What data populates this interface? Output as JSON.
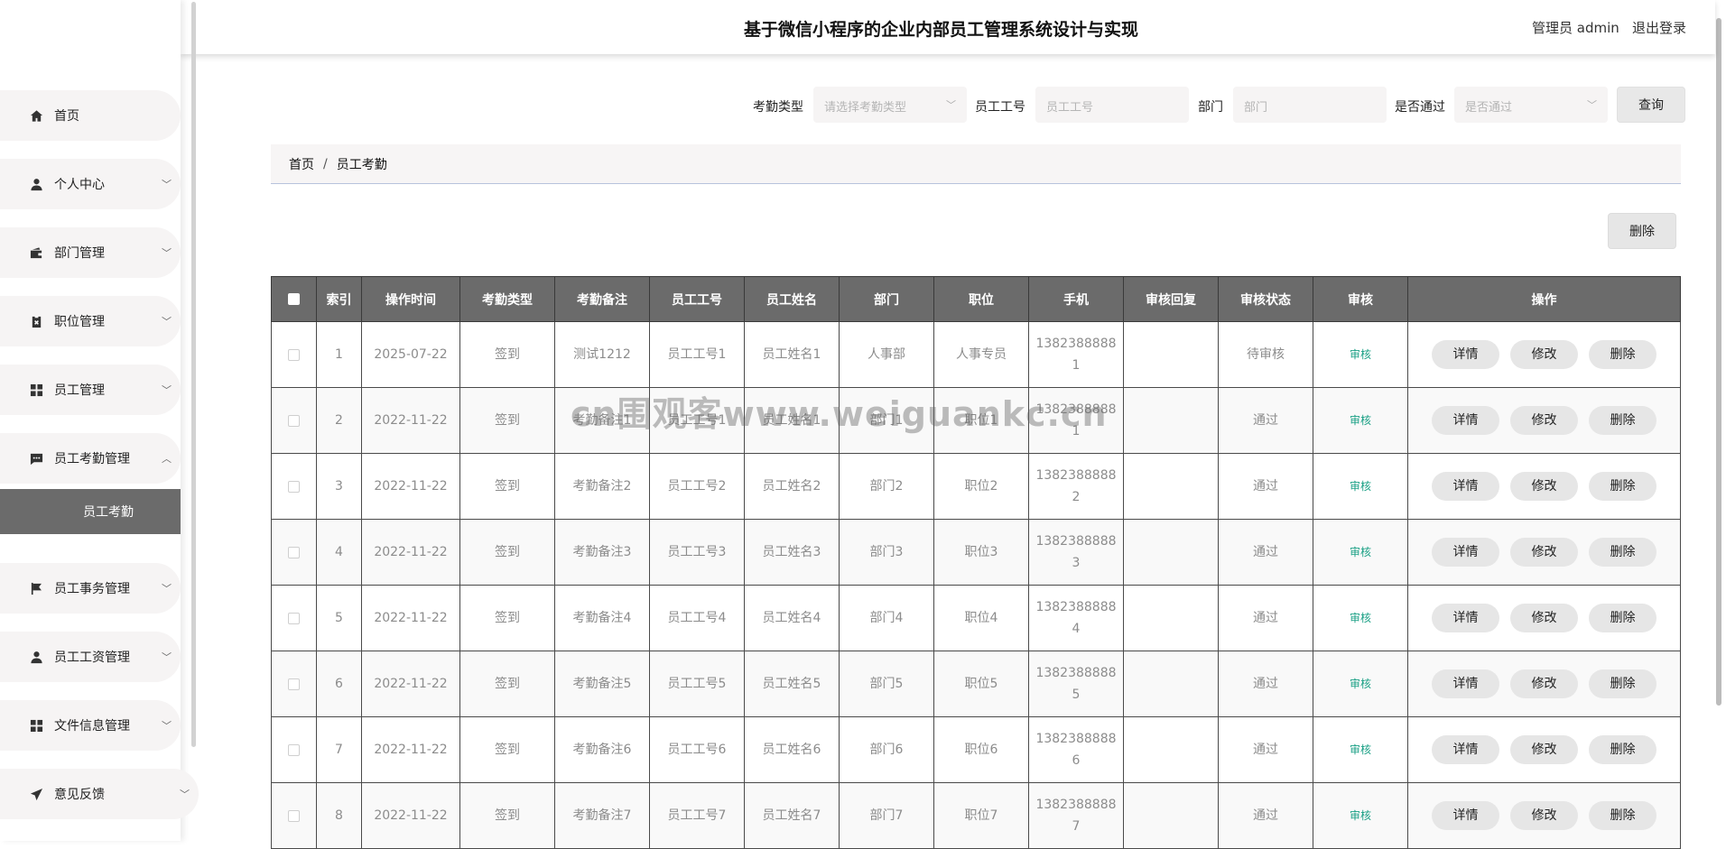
{
  "header": {
    "title": "基于微信小程序的企业内部员工管理系统设计与实现",
    "admin": "管理员 admin",
    "logout": "退出登录"
  },
  "sidebar": {
    "items": [
      {
        "label": "首页",
        "icon": "home-icon",
        "chevron": ""
      },
      {
        "label": "个人中心",
        "icon": "user-icon",
        "chevron": "﹀"
      },
      {
        "label": "部门管理",
        "icon": "wallet-icon",
        "chevron": "﹀"
      },
      {
        "label": "职位管理",
        "icon": "clipboard-x-icon",
        "chevron": "﹀"
      },
      {
        "label": "员工管理",
        "icon": "grid-icon",
        "chevron": "﹀"
      },
      {
        "label": "员工考勤管理",
        "icon": "chat-icon",
        "chevron": "︿"
      },
      {
        "label": "员工事务管理",
        "icon": "flag-icon",
        "chevron": "﹀"
      },
      {
        "label": "员工工资管理",
        "icon": "user-icon",
        "chevron": "﹀"
      },
      {
        "label": "文件信息管理",
        "icon": "grid-icon",
        "chevron": "﹀"
      },
      {
        "label": "意见反馈",
        "icon": "send-icon",
        "chevron": "﹀"
      }
    ],
    "active_sub": "员工考勤"
  },
  "search": {
    "type_label": "考勤类型",
    "type_placeholder": "请选择考勤类型",
    "id_label": "员工工号",
    "id_placeholder": "员工工号",
    "dept_label": "部门",
    "dept_placeholder": "部门",
    "pass_label": "是否通过",
    "pass_placeholder": "是否通过",
    "query_label": "查询"
  },
  "breadcrumb": {
    "home": "首页",
    "sep": "/",
    "current": "员工考勤"
  },
  "delete_label": "删除",
  "table": {
    "headers": [
      "索引",
      "操作时间",
      "考勤类型",
      "考勤备注",
      "员工工号",
      "员工姓名",
      "部门",
      "职位",
      "手机",
      "审核回复",
      "审核状态",
      "审核",
      "操作"
    ],
    "rows": [
      {
        "idx": "1",
        "time": "2025-07-22",
        "type": "签到",
        "note": "测试1212",
        "emp_id": "员工工号1",
        "name": "员工姓名1",
        "dept": "人事部",
        "pos": "人事专员",
        "phone": "1382388888\n1",
        "reply": "",
        "status": "待审核",
        "audit": "审核"
      },
      {
        "idx": "2",
        "time": "2022-11-22",
        "type": "签到",
        "note": "考勤备注1",
        "emp_id": "员工工号1",
        "name": "员工姓名1",
        "dept": "部门1",
        "pos": "职位1",
        "phone": "1382388888\n1",
        "reply": "",
        "status": "通过",
        "audit": "审核"
      },
      {
        "idx": "3",
        "time": "2022-11-22",
        "type": "签到",
        "note": "考勤备注2",
        "emp_id": "员工工号2",
        "name": "员工姓名2",
        "dept": "部门2",
        "pos": "职位2",
        "phone": "1382388888\n2",
        "reply": "",
        "status": "通过",
        "audit": "审核"
      },
      {
        "idx": "4",
        "time": "2022-11-22",
        "type": "签到",
        "note": "考勤备注3",
        "emp_id": "员工工号3",
        "name": "员工姓名3",
        "dept": "部门3",
        "pos": "职位3",
        "phone": "1382388888\n3",
        "reply": "",
        "status": "通过",
        "audit": "审核"
      },
      {
        "idx": "5",
        "time": "2022-11-22",
        "type": "签到",
        "note": "考勤备注4",
        "emp_id": "员工工号4",
        "name": "员工姓名4",
        "dept": "部门4",
        "pos": "职位4",
        "phone": "1382388888\n4",
        "reply": "",
        "status": "通过",
        "audit": "审核"
      },
      {
        "idx": "6",
        "time": "2022-11-22",
        "type": "签到",
        "note": "考勤备注5",
        "emp_id": "员工工号5",
        "name": "员工姓名5",
        "dept": "部门5",
        "pos": "职位5",
        "phone": "1382388888\n5",
        "reply": "",
        "status": "通过",
        "audit": "审核"
      },
      {
        "idx": "7",
        "time": "2022-11-22",
        "type": "签到",
        "note": "考勤备注6",
        "emp_id": "员工工号6",
        "name": "员工姓名6",
        "dept": "部门6",
        "pos": "职位6",
        "phone": "1382388888\n6",
        "reply": "",
        "status": "通过",
        "audit": "审核"
      },
      {
        "idx": "8",
        "time": "2022-11-22",
        "type": "签到",
        "note": "考勤备注7",
        "emp_id": "员工工号7",
        "name": "员工姓名7",
        "dept": "部门7",
        "pos": "职位7",
        "phone": "1382388888\n7",
        "reply": "",
        "status": "通过",
        "audit": "审核"
      }
    ],
    "actions": [
      "详情",
      "修改",
      "删除"
    ]
  },
  "watermark": "cn围观客www.weiguankc.cn",
  "colors": {
    "accent": "#6b6b6b",
    "audit_link": "#1aa085",
    "panel_bg": "#f6f4f4"
  }
}
